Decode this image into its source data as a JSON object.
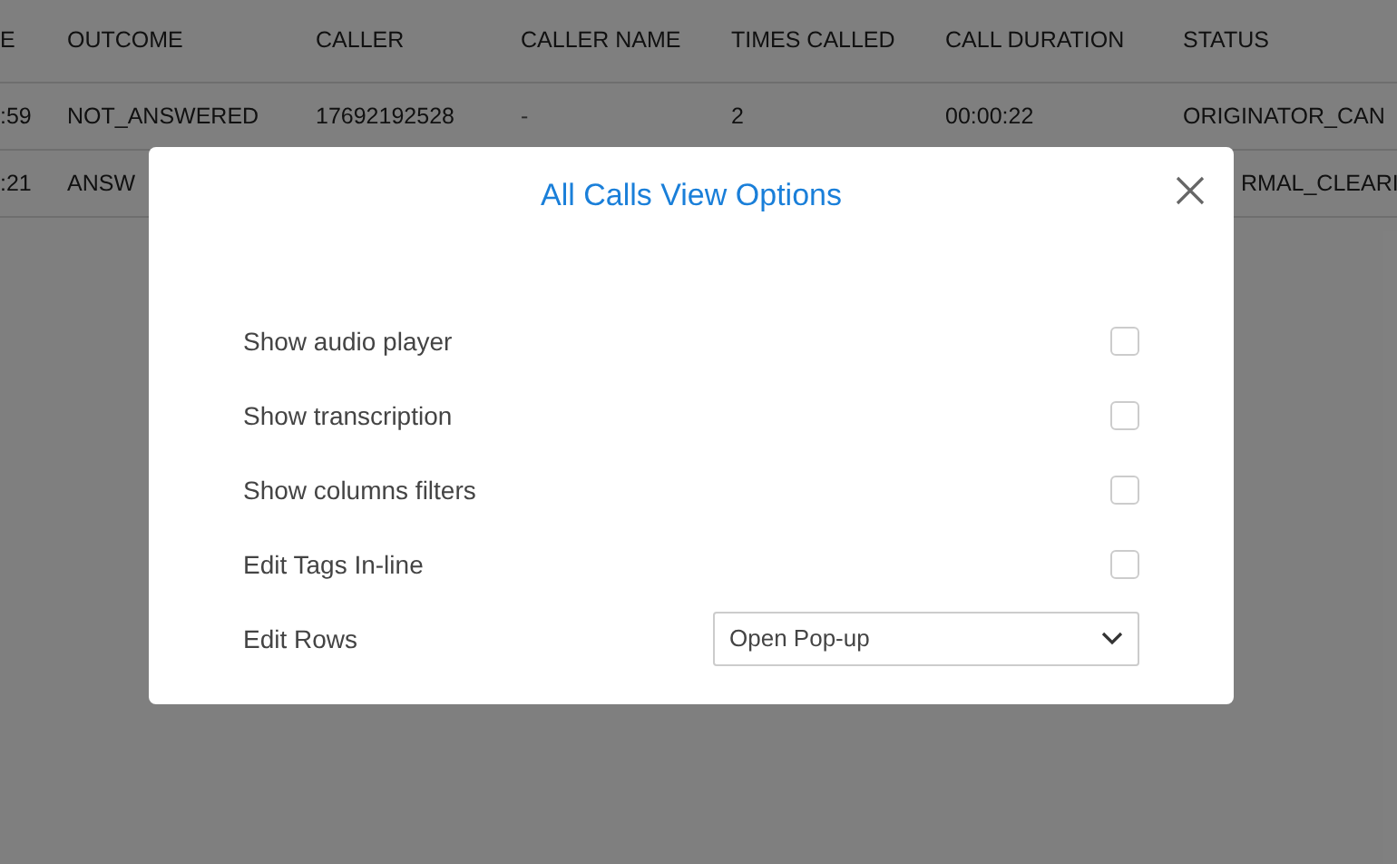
{
  "table": {
    "columns": [
      "E",
      "OUTCOME",
      "CALLER",
      "CALLER NAME",
      "TIMES CALLED",
      "CALL DURATION",
      "STATUS"
    ],
    "rows": [
      {
        "cells": [
          ":59",
          "NOT_ANSWERED",
          "17692192528",
          "-",
          "2",
          "00:00:22",
          "ORIGINATOR_CAN"
        ]
      },
      {
        "cells": [
          ":21",
          "ANSW",
          "",
          "",
          "",
          "",
          "RMAL_CLEARI"
        ]
      }
    ]
  },
  "dialog": {
    "title": "All Calls View Options",
    "options": [
      {
        "kind": "checkbox",
        "label": "Show audio player",
        "checked": false
      },
      {
        "kind": "checkbox",
        "label": "Show transcription",
        "checked": false
      },
      {
        "kind": "checkbox",
        "label": "Show columns filters",
        "checked": false
      },
      {
        "kind": "checkbox",
        "label": "Edit Tags In-line",
        "checked": false
      },
      {
        "kind": "select",
        "label": "Edit Rows",
        "value": "Open Pop-up"
      }
    ]
  }
}
